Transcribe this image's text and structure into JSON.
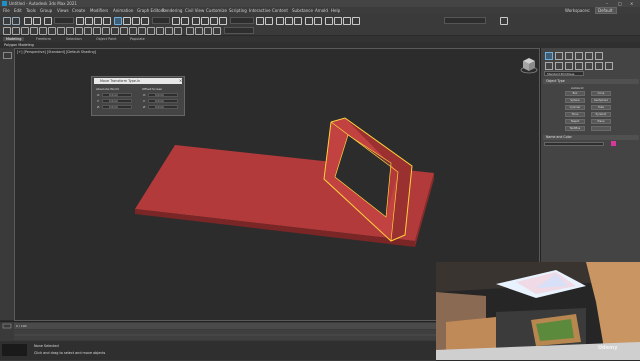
{
  "window": {
    "title": "Untitled - Autodesk 3ds Max 2021"
  },
  "menubar": {
    "items": [
      "File",
      "Edit",
      "Tools",
      "Group",
      "Views",
      "Create",
      "Modifiers",
      "Animation",
      "Graph Editors",
      "Rendering",
      "Civil View",
      "Customize",
      "Scripting",
      "Interactive",
      "Content",
      "Substance",
      "Arnold",
      "Help"
    ],
    "right": [
      "Workspaces:",
      "Default"
    ]
  },
  "ribbon": {
    "tabs": [
      "Modeling",
      "Freeform",
      "Selection",
      "Object Paint",
      "Populate"
    ],
    "sub": "Polygon Modeling"
  },
  "viewport": {
    "label": "[+] [Perspective] [Standard] [Default Shading]"
  },
  "dialog": {
    "title": "Move Transform Type-In",
    "absolute_label": "Absolute:World",
    "offset_label": "Offset:Screen",
    "axes": [
      "X:",
      "Y:",
      "Z:"
    ],
    "abs_values": [
      "0.0mm",
      "0.0mm",
      "0.0mm"
    ],
    "offset_values": [
      "0.0mm",
      "0.0mm",
      "0.0mm"
    ]
  },
  "command_panel": {
    "dropdown": "Standard Primitives",
    "object_type": "Object Type",
    "autogrid": "AutoGrid",
    "buttons": [
      "Box",
      "Cone",
      "Sphere",
      "GeoSphere",
      "Cylinder",
      "Tube",
      "Torus",
      "Pyramid",
      "Teapot",
      "Plane",
      "TextPlus",
      ""
    ],
    "name_and_color": "Name and Color",
    "object_color": "#d4389a"
  },
  "timeline": {
    "frame": "0 / 100"
  },
  "status": {
    "line1": "None Selected",
    "line2": "Click and drag to select and move objects"
  },
  "watermark": {
    "text": "Udemy"
  },
  "colors": {
    "accent": "#6fb0e0",
    "selection": "#ffd23c",
    "object": "#b53b3b"
  }
}
